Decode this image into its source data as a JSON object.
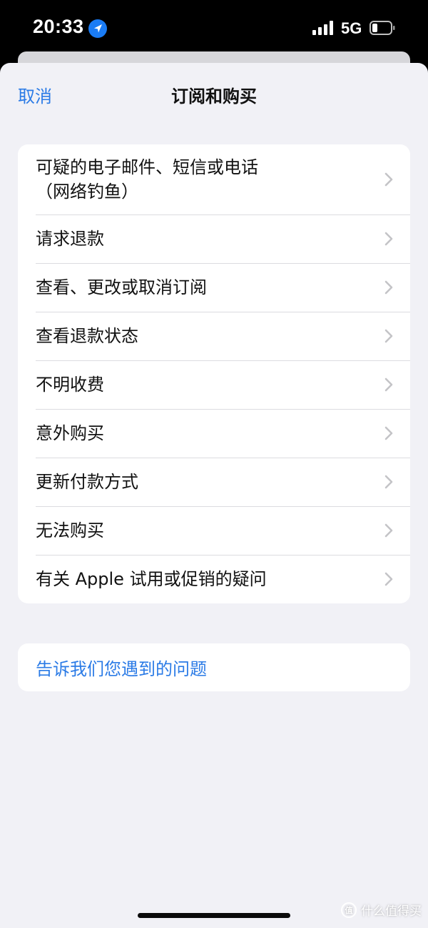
{
  "status_bar": {
    "time": "20:33",
    "network": "5G",
    "icons": [
      "location-arrow-icon",
      "cellular-signal-icon",
      "battery-icon"
    ]
  },
  "nav": {
    "cancel_label": "取消",
    "title": "订阅和购买"
  },
  "menu": {
    "items": [
      {
        "label": "可疑的电子邮件、短信或电话\n（网络钓鱼）"
      },
      {
        "label": "请求退款"
      },
      {
        "label": "查看、更改或取消订阅"
      },
      {
        "label": "查看退款状态"
      },
      {
        "label": "不明收费"
      },
      {
        "label": "意外购买"
      },
      {
        "label": "更新付款方式"
      },
      {
        "label": "无法购买"
      },
      {
        "label": "有关 Apple 试用或促销的疑问"
      }
    ]
  },
  "feedback": {
    "label": "告诉我们您遇到的问题"
  },
  "watermark": {
    "logo_text": "值",
    "text": "什么值得买"
  },
  "colors": {
    "accent": "#2b7be6",
    "background": "#f1f1f6",
    "card": "#ffffff",
    "separator": "#dcdce0",
    "chevron": "#c4c4c7"
  }
}
